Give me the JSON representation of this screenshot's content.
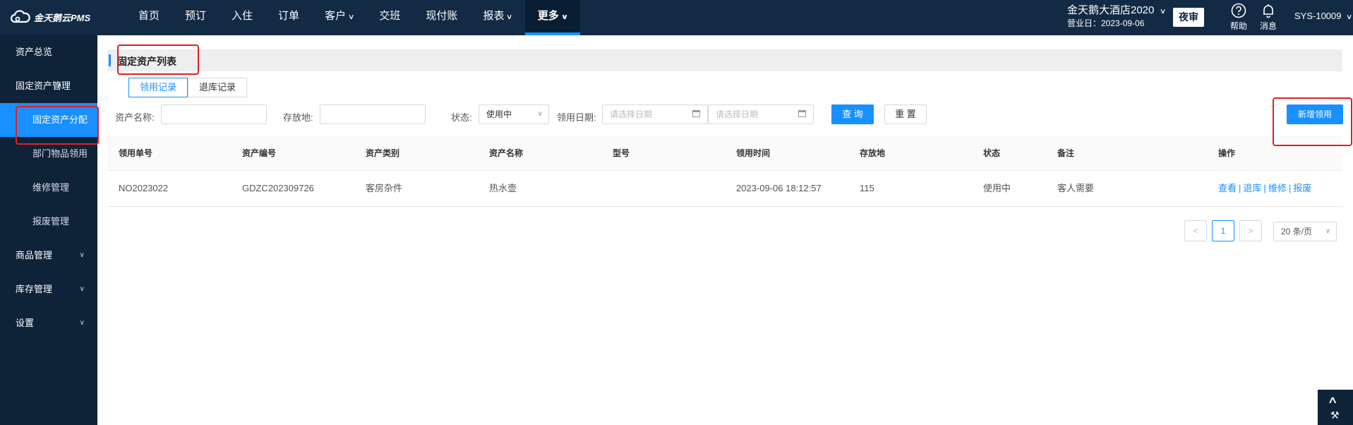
{
  "brand": {
    "logo_text": "金天鹅云PMS"
  },
  "nav": {
    "items": [
      {
        "label": "首页",
        "dropdown": false
      },
      {
        "label": "预订",
        "dropdown": false
      },
      {
        "label": "入住",
        "dropdown": false
      },
      {
        "label": "订单",
        "dropdown": false
      },
      {
        "label": "客户",
        "dropdown": true
      },
      {
        "label": "交班",
        "dropdown": false
      },
      {
        "label": "现付账",
        "dropdown": false
      },
      {
        "label": "报表",
        "dropdown": true
      },
      {
        "label": "更多",
        "dropdown": true,
        "active": true
      }
    ]
  },
  "header": {
    "hotel_name": "金天鹅大酒店2020",
    "business_date": "营业日：2023-09-06",
    "night_audit": "夜审",
    "help": "帮助",
    "messages": "消息",
    "user": "SYS-10009"
  },
  "sidebar": {
    "items": [
      {
        "label": "资产总览",
        "level": 1
      },
      {
        "label": "固定资产管理",
        "level": 1,
        "expanded": true
      },
      {
        "label": "固定资产分配",
        "level": 2,
        "active": true
      },
      {
        "label": "部门物品领用",
        "level": 2
      },
      {
        "label": "维修管理",
        "level": 2
      },
      {
        "label": "报废管理",
        "level": 2
      },
      {
        "label": "商品管理",
        "level": 1,
        "collapsible": true
      },
      {
        "label": "库存管理",
        "level": 1,
        "collapsible": true
      },
      {
        "label": "设置",
        "level": 1,
        "collapsible": true
      }
    ]
  },
  "page": {
    "title": "固定资产列表",
    "tabs": [
      {
        "label": "领用记录",
        "active": true
      },
      {
        "label": "退库记录"
      }
    ]
  },
  "filters": {
    "asset_name_label": "资产名称:",
    "asset_name_value": "",
    "location_label": "存放地:",
    "location_value": "",
    "status_label": "状态:",
    "status_value": "使用中",
    "date_label": "领用日期:",
    "date_start_placeholder": "请选择日期",
    "date_end_placeholder": "请选择日期",
    "query_button": "查 询",
    "reset_button": "重 置",
    "add_button": "新增领用"
  },
  "table": {
    "columns": [
      "领用单号",
      "资产编号",
      "资产类别",
      "资产名称",
      "型号",
      "领用时间",
      "存放地",
      "状态",
      "备注",
      "操作"
    ],
    "rows": [
      {
        "order_no": "NO2023022",
        "asset_code": "GDZC202309726",
        "category": "客房杂件",
        "name": "热水壶",
        "model": "",
        "time": "2023-09-06 18:12:57",
        "location": "115",
        "status": "使用中",
        "remark": "客人需要",
        "actions": [
          "查看",
          "退库",
          "维修",
          "报废"
        ]
      }
    ]
  },
  "pagination": {
    "current_page": "1",
    "page_size": "20 条/页"
  },
  "colors": {
    "topbar": "#122a44",
    "sidebar": "#0e2238",
    "primary": "#1890ff",
    "highlight_box": "#e02020"
  }
}
